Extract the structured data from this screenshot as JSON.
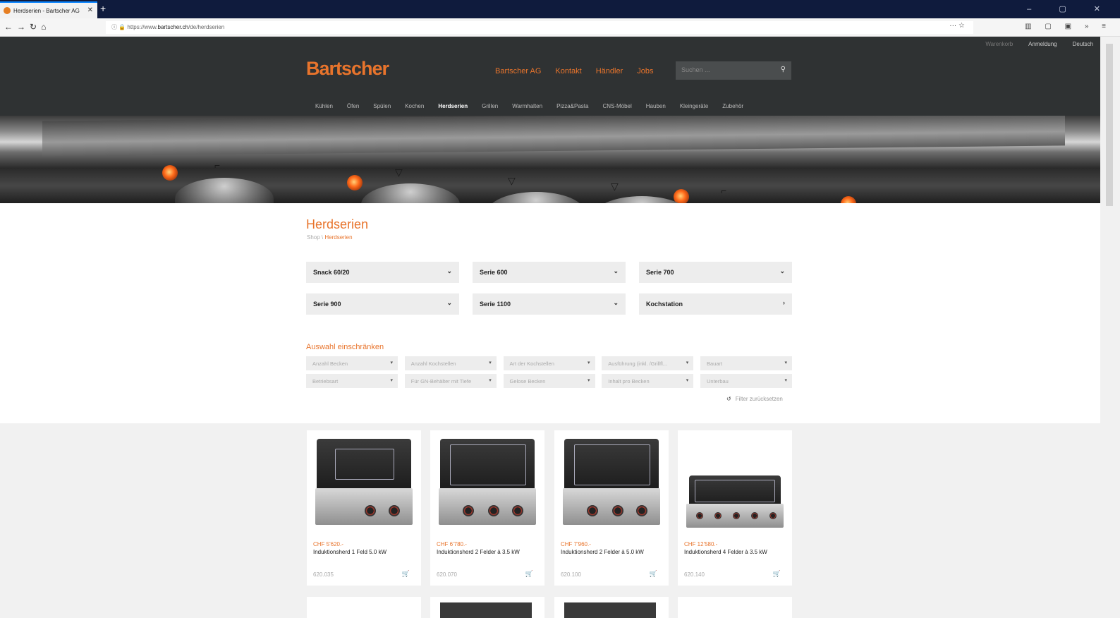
{
  "browser": {
    "tab_title": "Herdserien - Bartscher AG",
    "tab_close": "✕",
    "new_tab": "+",
    "url_prefix": "https://www.",
    "url_domain": "bartscher.ch",
    "url_path": "/de/herdserien",
    "window_controls": "– ▢ ✕"
  },
  "header": {
    "logo": "Bartscher",
    "nav": [
      "Bartscher AG",
      "Kontakt",
      "Händler",
      "Jobs"
    ],
    "search_placeholder": "Suchen ...",
    "top_links": {
      "cart": "Warenkorb",
      "login": "Anmeldung",
      "language": "Deutsch"
    },
    "categories": [
      "Kühlen",
      "Öfen",
      "Spülen",
      "Kochen",
      "Herdserien",
      "Grillen",
      "Warmhalten",
      "Pizza&Pasta",
      "CNS-Möbel",
      "Hauben",
      "Kleingeräte",
      "Zubehör"
    ],
    "active_category": "Herdserien"
  },
  "page": {
    "title": "Herdserien",
    "breadcrumb_root": "Shop",
    "breadcrumb_sep": "\\",
    "breadcrumb_current": "Herdserien"
  },
  "series": [
    {
      "label": "Snack 60/20",
      "icon": "chevron-down"
    },
    {
      "label": "Serie 600",
      "icon": "chevron-down"
    },
    {
      "label": "Serie 700",
      "icon": "chevron-down"
    },
    {
      "label": "Serie 900",
      "icon": "chevron-down"
    },
    {
      "label": "Serie 1100",
      "icon": "chevron-down"
    },
    {
      "label": "Kochstation",
      "icon": "chevron-right"
    }
  ],
  "filters": {
    "title": "Auswahl einschränken",
    "items": [
      "Anzahl Becken",
      "Anzahl Kochstellen",
      "Art der Kochstellen",
      "Ausführung (inkl. /Grillfl...",
      "Bauart",
      "Betriebsart",
      "Für GN-Behälter mit Tiefe",
      "Gelose Becken",
      "Inhalt pro Becken",
      "Unterbau"
    ],
    "reset": "Filter zurücksetzen"
  },
  "products": [
    {
      "price": "CHF 5'620.-",
      "name": "Induktionsherd 1 Feld 5.0 kW",
      "sku": "620.035"
    },
    {
      "price": "CHF 6'780.-",
      "name": "Induktionsherd 2 Felder à 3.5 kW",
      "sku": "620.070"
    },
    {
      "price": "CHF 7'960.-",
      "name": "Induktionsherd 2 Felder à 5.0 kW",
      "sku": "620.100"
    },
    {
      "price": "CHF 12'580.-",
      "name": "Induktionsherd 4 Felder à 3.5 kW",
      "sku": "620.140"
    }
  ],
  "colors": {
    "accent": "#e8742c",
    "header_bg": "#2f3233",
    "tab_bar": "#0f1b3d"
  }
}
